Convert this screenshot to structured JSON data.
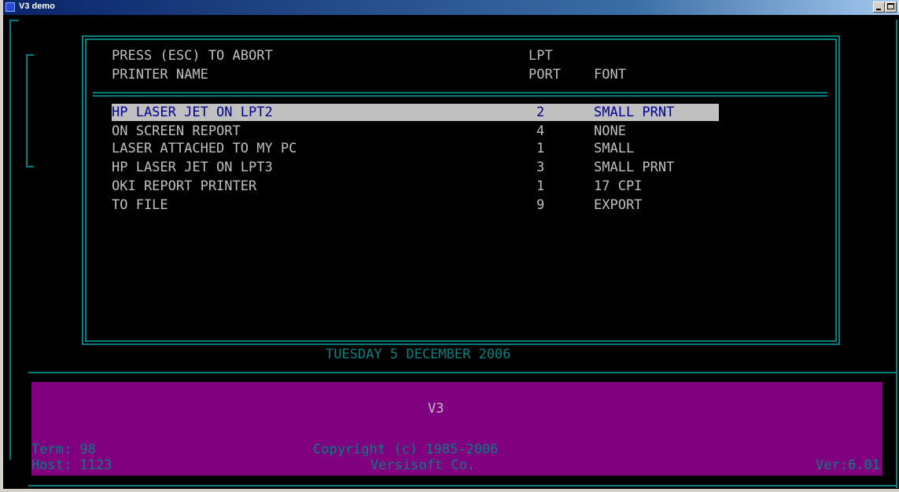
{
  "window": {
    "title": "V3 demo",
    "minimize_label": "",
    "maximize_label": ""
  },
  "report": {
    "abort_hint": "PRESS (ESC) TO ABORT",
    "col_printer_name": "PRINTER NAME",
    "col_lpt": "LPT",
    "col_port": "PORT",
    "col_font": "FONT",
    "rows": [
      {
        "name": "HP LASER JET ON LPT2",
        "port": "2",
        "font": "SMALL PRNT"
      },
      {
        "name": "ON SCREEN REPORT",
        "port": "4",
        "font": "NONE"
      },
      {
        "name": "LASER ATTACHED TO MY PC",
        "port": "1",
        "font": "SMALL"
      },
      {
        "name": "HP LASER JET ON LPT3",
        "port": "3",
        "font": "SMALL PRNT"
      },
      {
        "name": "OKI REPORT PRINTER",
        "port": "1",
        "font": "17 CPI"
      },
      {
        "name": "TO FILE",
        "port": "9",
        "font": "EXPORT"
      }
    ],
    "selected_index": 0
  },
  "date_line": "TUESDAY 5 DECEMBER 2006",
  "footer": {
    "app_name": "V3",
    "term": "Term: 98",
    "host": "Host: 1123",
    "copyright": "Copyright (c) 1985-2006",
    "company": "Versisoft Co.",
    "version": "Ver:6.01"
  },
  "colors": {
    "screen_bg": "#000000",
    "frame": "#008080",
    "text": "#c0c0c0",
    "highlight_bg": "#c0c0c0",
    "highlight_text": "#00008b",
    "footer_bg": "#800080"
  }
}
